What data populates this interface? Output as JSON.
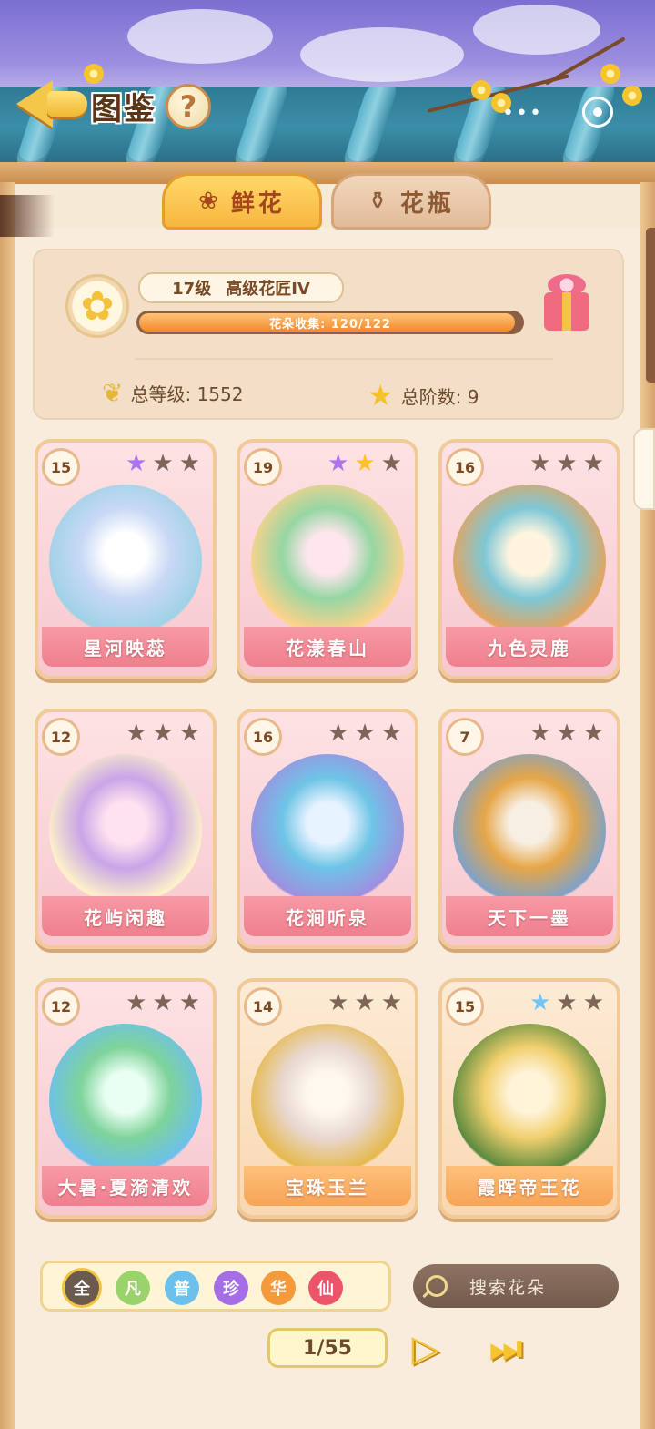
{
  "header": {
    "title": "图鉴",
    "help_label": "?"
  },
  "tabs": [
    {
      "label": "鲜花",
      "icon": "rose-icon",
      "selected": true
    },
    {
      "label": "花瓶",
      "icon": "vase-icon",
      "selected": false
    }
  ],
  "profile": {
    "level": "17级",
    "rank": "高级花匠IV",
    "collection_label": "花朵收集: 120/122",
    "collection_progress": 0.9836,
    "total_level_label": "总等级: 1552",
    "total_stage_label": "总阶数: 9"
  },
  "cards": [
    {
      "name": "星河映蕊",
      "level": "15",
      "stars": [
        "purple",
        "grey",
        "grey"
      ],
      "theme": "pink"
    },
    {
      "name": "花漾春山",
      "level": "19",
      "stars": [
        "purple",
        "gold",
        "grey"
      ],
      "theme": "pink"
    },
    {
      "name": "九色灵鹿",
      "level": "16",
      "stars": [
        "grey",
        "grey",
        "grey"
      ],
      "theme": "pink"
    },
    {
      "name": "花屿闲趣",
      "level": "12",
      "stars": [
        "grey",
        "grey",
        "grey"
      ],
      "theme": "pink"
    },
    {
      "name": "花涧听泉",
      "level": "16",
      "stars": [
        "grey",
        "grey",
        "grey"
      ],
      "theme": "pink"
    },
    {
      "name": "天下一墨",
      "level": "7",
      "stars": [
        "grey",
        "grey",
        "grey"
      ],
      "theme": "pink"
    },
    {
      "name": "大暑·夏漪清欢",
      "level": "12",
      "stars": [
        "grey",
        "grey",
        "grey"
      ],
      "theme": "pink"
    },
    {
      "name": "宝珠玉兰",
      "level": "14",
      "stars": [
        "grey",
        "grey",
        "grey"
      ],
      "theme": "orange"
    },
    {
      "name": "霞晖帝王花",
      "level": "15",
      "stars": [
        "blue",
        "grey",
        "grey"
      ],
      "theme": "orange"
    }
  ],
  "filters": [
    {
      "label": "全",
      "color": "#6b5a4e",
      "selected": true
    },
    {
      "label": "凡",
      "color": "#9ad36a"
    },
    {
      "label": "普",
      "color": "#6cc0ec"
    },
    {
      "label": "珍",
      "color": "#a56ee6"
    },
    {
      "label": "华",
      "color": "#f59a3a"
    },
    {
      "label": "仙",
      "color": "#ec5469"
    }
  ],
  "search": {
    "placeholder": "搜索花朵"
  },
  "pagination": {
    "label": "1/55",
    "current": 1,
    "total": 55
  }
}
